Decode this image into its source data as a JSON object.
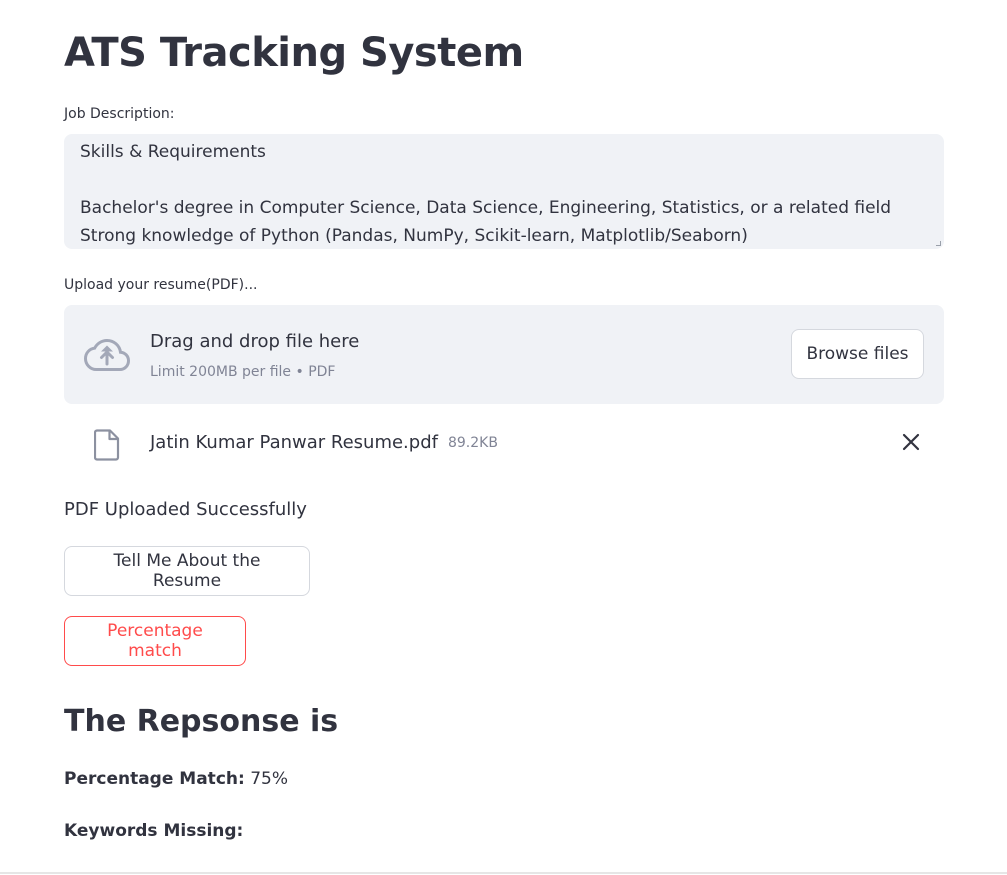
{
  "app": {
    "title": "ATS Tracking System"
  },
  "job_description": {
    "label": "Job Description:",
    "value": "Skills & Requirements\n\nBachelor's degree in Computer Science, Data Science, Engineering, Statistics, or a related field\nStrong knowledge of Python (Pandas, NumPy, Scikit-learn, Matplotlib/Seaborn)"
  },
  "uploader": {
    "label": "Upload your resume(PDF)...",
    "drop_title": "Drag and drop file here",
    "drop_subtitle": "Limit 200MB per file • PDF",
    "browse_label": "Browse files",
    "icon": "cloud-upload-icon"
  },
  "uploaded_file": {
    "name": "Jatin Kumar Panwar Resume.pdf",
    "size": "89.2KB",
    "icon": "file-icon"
  },
  "status": {
    "message": "PDF Uploaded Successfully"
  },
  "actions": {
    "tell_label": "Tell Me About the Resume",
    "match_label": "Percentage match"
  },
  "response": {
    "heading": "The Repsonse is",
    "percentage_label": "Percentage Match:",
    "percentage_value": "75%",
    "keywords_label": "Keywords Missing:"
  },
  "colors": {
    "accent": "#ff4b4b",
    "input_bg": "#f0f2f6",
    "text": "#31333f",
    "muted": "#808495"
  }
}
